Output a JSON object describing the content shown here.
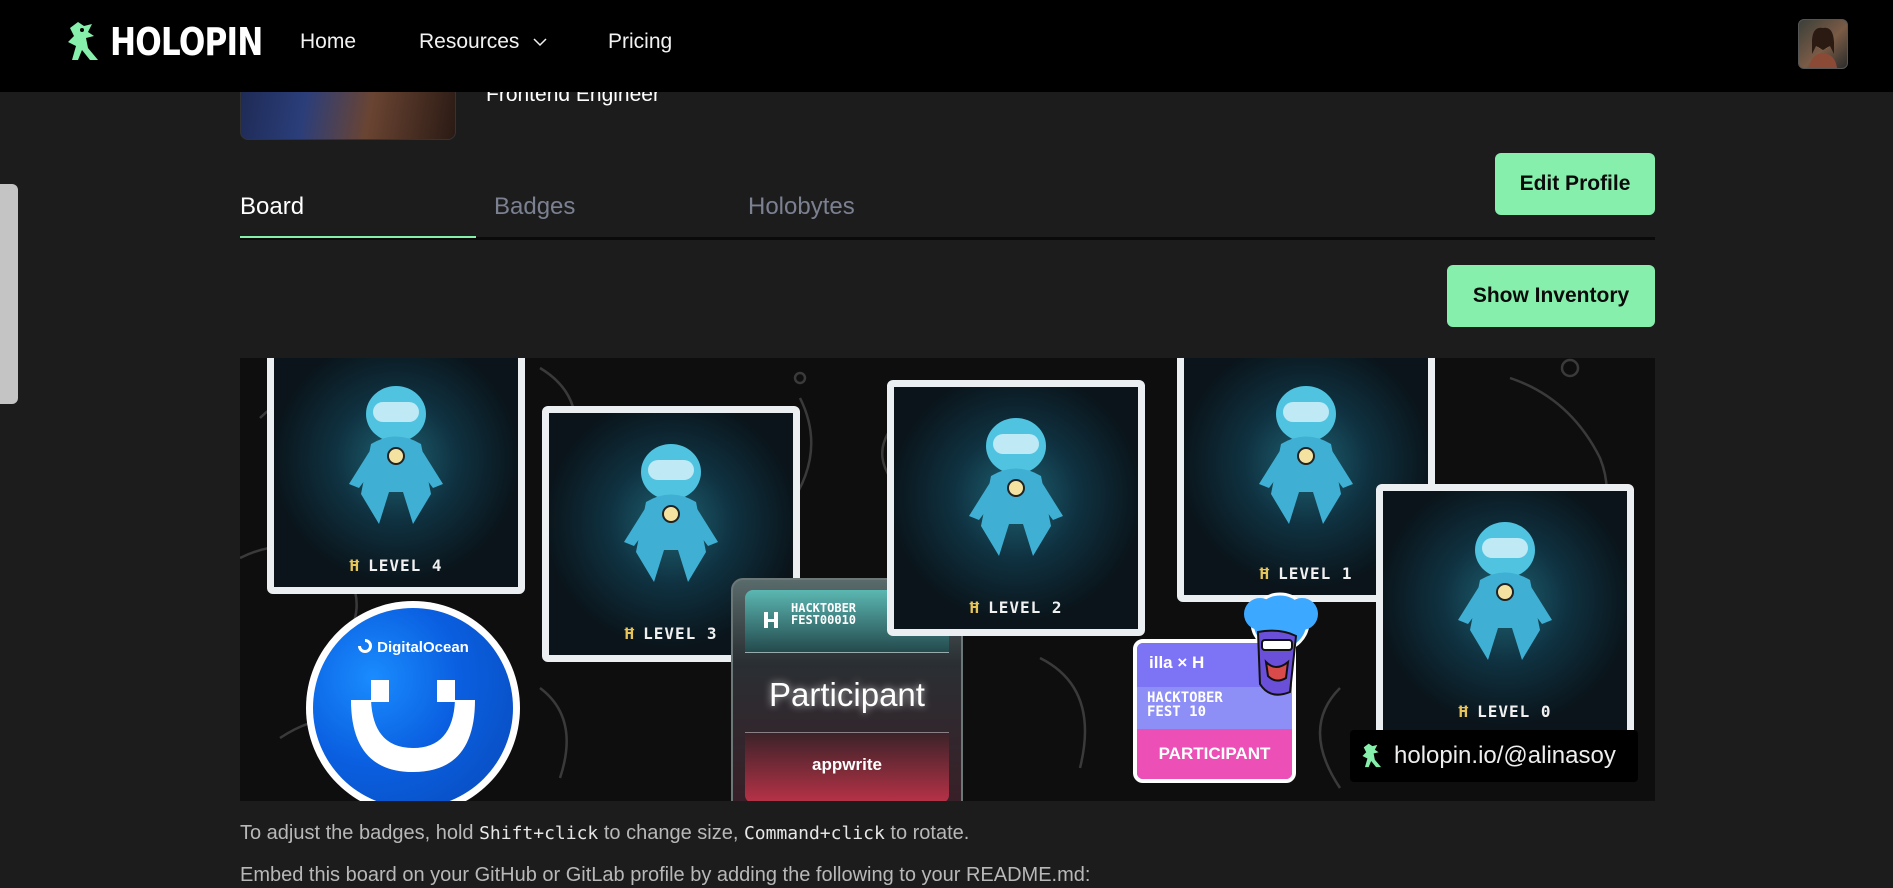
{
  "nav": {
    "brand": "HOLOPIN",
    "links": [
      "Home",
      "Resources",
      "Pricing"
    ]
  },
  "profile": {
    "job_title": "Frontend Engineer",
    "edit_button": "Edit Profile"
  },
  "tabs": [
    "Board",
    "Badges",
    "Holobytes"
  ],
  "board": {
    "show_inventory": "Show Inventory",
    "levels": [
      "LEVEL 4",
      "LEVEL 3",
      "LEVEL 2",
      "LEVEL 1",
      "LEVEL 0"
    ],
    "digitalocean": "DigitalOcean",
    "appwrite_hack": "HACKTOBER\nFEST00010",
    "appwrite_participant": "Participant",
    "appwrite_logo": "appwrite",
    "hack_badge_logo": "illa × H",
    "hack_badge_title": "HACKTOBER\nFEST 10",
    "hack_badge_participant": "PARTICIPANT",
    "profile_url": "holopin.io/@alinasoy"
  },
  "hints": {
    "adjust_prefix": "To adjust the badges, hold ",
    "shift_click": "Shift+click",
    "adjust_mid": " to change size, ",
    "cmd_click": "Command+click",
    "adjust_suffix": " to rotate.",
    "embed": "Embed this board on your GitHub or GitLab profile by adding the following to your README.md:"
  },
  "colors": {
    "accent": "#86efac",
    "background": "#1c1c1c",
    "nav": "#000000"
  }
}
